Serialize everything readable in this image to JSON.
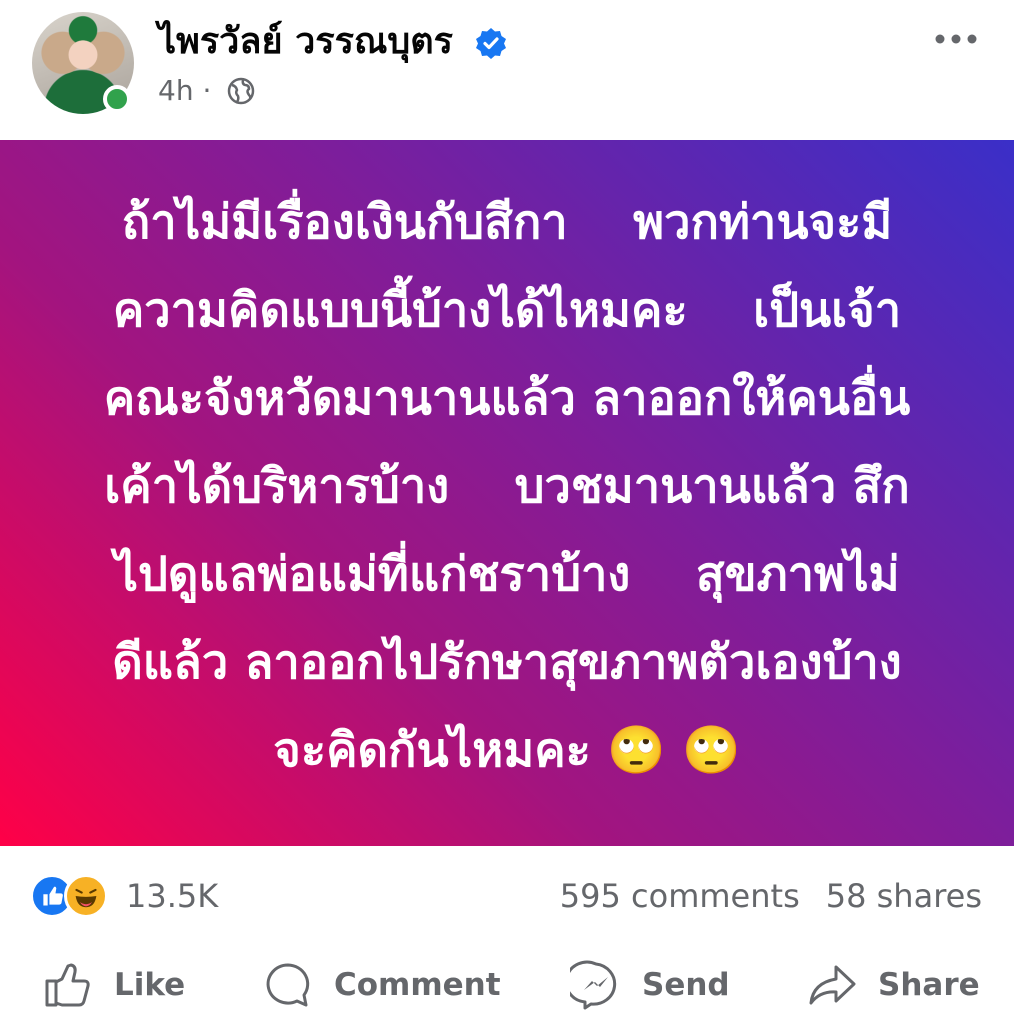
{
  "post": {
    "author_name": "ไพรวัลย์ วรรณบุตร",
    "time": "4h",
    "separator": "·",
    "privacy_icon": "globe-icon",
    "verified_icon": "verified-badge-icon",
    "more_icon": "more-options-icon",
    "text_lines": [
      "ถ้าไม่มีเรื่องเงินกับสีกา    พวกท่านจะมี",
      "ความคิดแบบนี้บ้างได้ไหมคะ    เป็นเจ้า",
      "คณะจังหวัดมานานแล้ว ลาออกให้คนอื่น",
      "เค้าได้บริหารบ้าง    บวชมานานแล้ว สึก",
      "ไปดูแลพ่อแม่ที่แก่ชราบ้าง    สุขภาพไม่",
      "ดีแล้ว ลาออกไปรักษาสุขภาพตัวเองบ้าง",
      "จะคิดกันไหมคะ 🙄 🙄"
    ],
    "background_colors": [
      "#ff0047",
      "#a3147f",
      "#7c1e9c",
      "#3a2fc8"
    ]
  },
  "stats": {
    "reaction_icons": [
      "like-icon",
      "haha-icon"
    ],
    "reaction_count": "13.5K",
    "comments": "595 comments",
    "shares": "58 shares"
  },
  "actions": {
    "like": "Like",
    "comment": "Comment",
    "send": "Send",
    "share": "Share"
  },
  "colors": {
    "online": "#31a24c",
    "verified": "#1877f2",
    "secondary_text": "#65676b"
  }
}
